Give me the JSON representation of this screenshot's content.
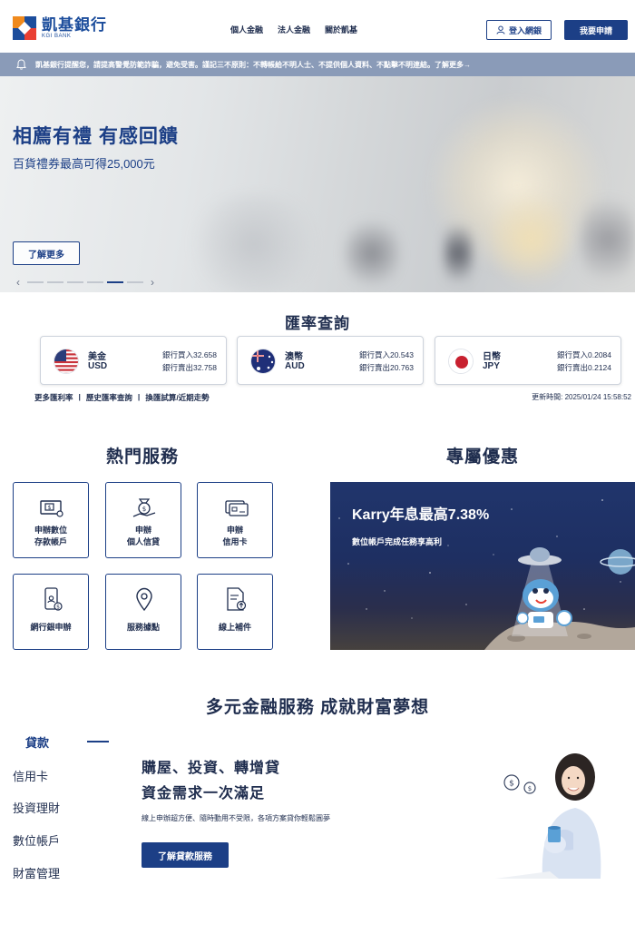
{
  "header": {
    "logo_name": "凱基銀行",
    "logo_sub": "KGI BANK",
    "nav": [
      "個人金融",
      "法人金融",
      "關於凱基"
    ],
    "login_label": "登入網銀",
    "apply_label": "我要申請"
  },
  "notice": {
    "text": "凱基銀行提醒您，請提高警覺防範詐騙，避免受害。謹記三不原則：不轉帳給不明人士、不提供個人資料、不點擊不明連結。",
    "link": "了解更多→"
  },
  "hero": {
    "title": "相薦有禮 有感回饋",
    "subtitle": "百貨禮券最高可得25,000元",
    "button": "了解更多",
    "prev": "‹",
    "next": "›",
    "active_slide": 5,
    "slide_count": 6
  },
  "rates": {
    "title": "匯率查詢",
    "cards": [
      {
        "name": "美金",
        "code": "USD",
        "buy": "銀行買入32.658",
        "sell": "銀行賣出32.758"
      },
      {
        "name": "澳幣",
        "code": "AUD",
        "buy": "銀行買入20.543",
        "sell": "銀行賣出20.763"
      },
      {
        "name": "日幣",
        "code": "JPY",
        "buy": "銀行買入0.2084",
        "sell": "銀行賣出0.2124"
      }
    ],
    "links": [
      "更多匯利率",
      "|",
      "歷史匯率查詢",
      "|",
      "換匯試算/近期走勢"
    ],
    "updated": "更新時間: 2025/01/24 15:58:52"
  },
  "services": {
    "title": "熱門服務",
    "items": [
      {
        "label1": "申辦數位",
        "label2": "存款帳戶"
      },
      {
        "label1": "申辦",
        "label2": "個人信貸"
      },
      {
        "label1": "申辦",
        "label2": "信用卡"
      },
      {
        "label1": "網行銀申辦",
        "label2": ""
      },
      {
        "label1": "服務據點",
        "label2": ""
      },
      {
        "label1": "線上補件",
        "label2": ""
      }
    ]
  },
  "promo": {
    "title": "專屬優惠",
    "banner_title": "Karry年息最高7.38%",
    "banner_sub": "數位帳戶完成任務享高利"
  },
  "wealth": {
    "title": "多元金融服務 成就財富夢想",
    "tabs": [
      "貸款",
      "信用卡",
      "投資理財",
      "數位帳戶",
      "財富管理"
    ],
    "headline1": "購屋、投資、轉增貸",
    "headline2": "資金需求一次滿足",
    "desc": "線上申辦超方便、隨時動用不受限，各項方案貸你輕鬆圓夢",
    "button": "了解貸款服務"
  },
  "colors": {
    "brand_navy": "#1c3f86",
    "notice_bar": "#8a9bb8",
    "logo_orange": "#f08a1d",
    "logo_red": "#e94033"
  }
}
